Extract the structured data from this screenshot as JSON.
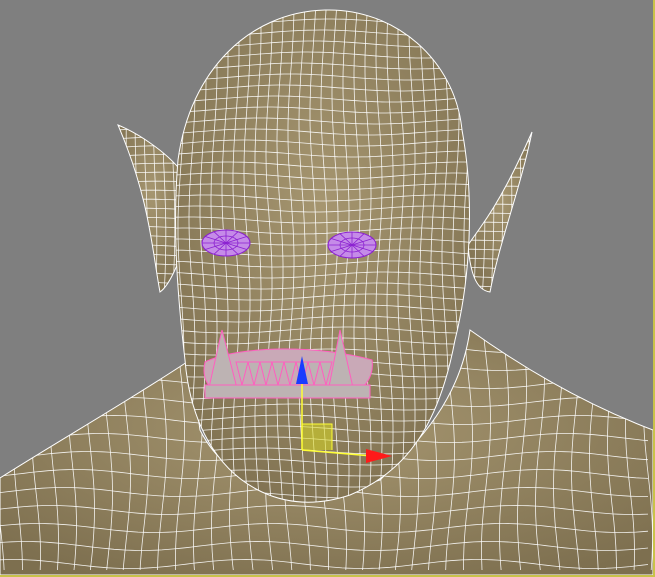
{
  "viewport": {
    "background_color": "#7f7f7f",
    "active_border_color": "#c9c24a"
  },
  "model": {
    "skin_color": "#a69670",
    "skin_shadow_color": "#7d6f4f",
    "wire_color": "#ffffff",
    "eye_color": "#c58be8",
    "eye_wire_color": "#8a1fd0",
    "mouth_color": "#c9a9b7",
    "teeth_color": "#bdb3b3",
    "teeth_wire_color": "#ff5fbf"
  },
  "gizmo": {
    "y_axis_color": "#1a3cff",
    "x_axis_color": "#ff1a1a",
    "plane_color": "#d8d820",
    "line_color": "#ffff33"
  }
}
